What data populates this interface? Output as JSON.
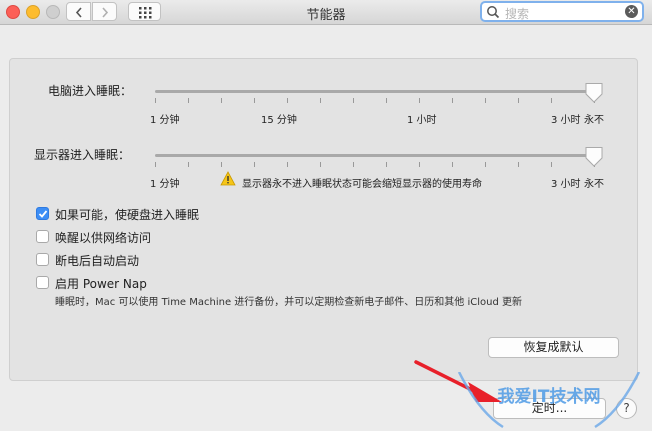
{
  "window": {
    "title": "节能器",
    "search_placeholder": "搜索"
  },
  "computer_sleep": {
    "label": "电脑进入睡眠：",
    "ticks": [
      "1 分钟",
      "15 分钟",
      "1 小时",
      "3 小时",
      "永不"
    ],
    "value": "永不"
  },
  "display_sleep": {
    "label": "显示器进入睡眠：",
    "ticks": [
      "1 分钟",
      "3 小时",
      "永不"
    ],
    "value": "永不",
    "warning": "显示器永不进入睡眠状态可能会缩短显示器的使用寿命"
  },
  "options": [
    {
      "label": "如果可能，使硬盘进入睡眠",
      "checked": true
    },
    {
      "label": "唤醒以供网络访问",
      "checked": false
    },
    {
      "label": "断电后自动启动",
      "checked": false
    },
    {
      "label": "启用 Power Nap",
      "checked": false
    }
  ],
  "power_nap_note": "睡眠时，Mac 可以使用 Time Machine 进行备份，并可以定期检查新电子邮件、日历和其他 iCloud 更新",
  "buttons": {
    "restore_defaults": "恢复成默认",
    "schedule": "定时...",
    "help": "?"
  },
  "watermark": "我爱IT技术网",
  "colors": {
    "accent": "#3d8ef5",
    "search_focus": "#7fb1ec",
    "arrow": "#e8202a",
    "warning": "#f5c518"
  }
}
